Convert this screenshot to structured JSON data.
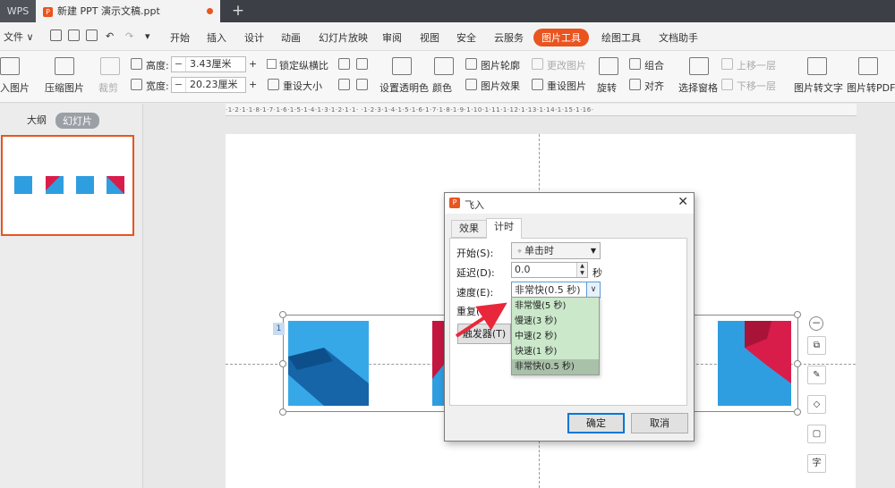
{
  "titlebar": {
    "app_tab": "WPS",
    "doc_tab": "新建 PPT 演示文稿.ppt",
    "doc_icon": "P",
    "add_tab": "+"
  },
  "menubar": {
    "file": "文件",
    "items": [
      "开始",
      "插入",
      "设计",
      "动画",
      "幻灯片放映",
      "审阅",
      "视图",
      "安全",
      "云服务",
      "图片工具",
      "绘图工具",
      "文档助手"
    ],
    "active": "图片工具"
  },
  "ribbon": {
    "insert_picture": "入图片",
    "compress": "压缩图片",
    "crop": "裁剪",
    "height_label": "高度:",
    "height_value": "3.43厘米",
    "width_label": "宽度:",
    "width_value": "20.23厘米",
    "lock_ratio": "锁定纵横比",
    "reset_size": "重设大小",
    "set_transparent": "设置透明色",
    "color": "颜色",
    "picture_outline": "图片轮廓",
    "change_picture": "更改图片",
    "picture_effect": "图片效果",
    "reset_picture": "重设图片",
    "rotate": "旋转",
    "group": "组合",
    "align": "对齐",
    "selection_pane": "选择窗格",
    "bring_forward": "上移一层",
    "send_backward": "下移一层",
    "pic_to_text": "图片转文字",
    "pic_to_pdf": "图片转PDF",
    "minus": "−",
    "plus": "+"
  },
  "leftpanel": {
    "tab_outline": "大纲",
    "tab_slides": "幻灯片"
  },
  "ruler_text": "·1·2·1·1·8·1·7·1·6·1·5·1·4·1·3·1·2·1·1·  ·1·2·3·1·4·1·5·1·6·1·7·1·8·1·9·1·10·1·11·1·12·1·13·1·14·1·15·1·16·",
  "slide": {
    "anim_number": "1",
    "minus": "−",
    "text_tool": "字"
  },
  "dialog": {
    "title": "飞入",
    "icon": "P",
    "close": "✕",
    "tabs": [
      "效果",
      "计时"
    ],
    "active_tab": "计时",
    "start_label": "开始(S):",
    "start_value": "单击时",
    "delay_label": "延迟(D):",
    "delay_value": "0.0",
    "delay_unit": "秒",
    "speed_label": "速度(E):",
    "speed_value": "非常快(0.5 秒)",
    "repeat_label": "重复(R):",
    "trigger_button": "触发器(T)",
    "ok_button": "确定",
    "cancel_button": "取消",
    "spin_up": "▲",
    "spin_down": "▼",
    "combo_arrow": "▼",
    "speed_arrow": "∨"
  },
  "speed_options": [
    "非常慢(5 秒)",
    "慢速(3 秒)",
    "中速(2 秒)",
    "快速(1 秒)",
    "非常快(0.5 秒)"
  ],
  "speed_selected_index": 4,
  "colors": {
    "accent": "#e9541f",
    "dropdown_bg": "#cbe8cb",
    "dropdown_selected": "#a9c0a9",
    "arrow_red": "#e8283a",
    "picture_blue": "#2f9ee0",
    "picture_dark_blue": "#1565a8",
    "picture_red": "#d81d4b"
  }
}
